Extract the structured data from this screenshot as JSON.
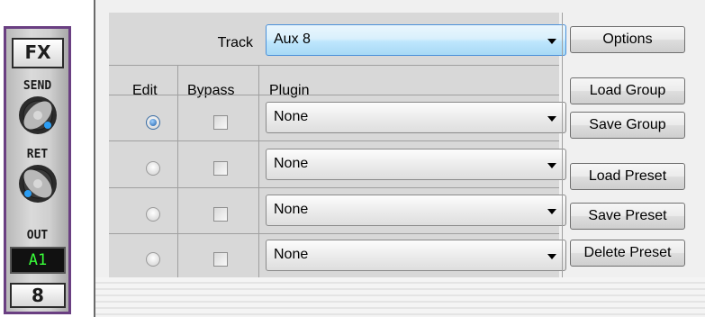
{
  "strip": {
    "fx_label": "FX",
    "send_label": "SEND",
    "ret_label": "RET",
    "out_label": "OUT",
    "out_value": "A1",
    "channel_number": "8",
    "colors": {
      "frame": "#6a3f82",
      "out_text": "#39ff39",
      "knob_dot": "#2a9df4"
    }
  },
  "track": {
    "label": "Track",
    "value": "Aux 8"
  },
  "headers": {
    "edit": "Edit",
    "bypass": "Bypass",
    "plugin": "Plugin"
  },
  "rows": [
    {
      "edit_selected": true,
      "bypass": false,
      "plugin": "None"
    },
    {
      "edit_selected": false,
      "bypass": false,
      "plugin": "None"
    },
    {
      "edit_selected": false,
      "bypass": false,
      "plugin": "None"
    },
    {
      "edit_selected": false,
      "bypass": false,
      "plugin": "None"
    }
  ],
  "buttons": {
    "options": "Options",
    "load_group": "Load Group",
    "save_group": "Save Group",
    "load_preset": "Load Preset",
    "save_preset": "Save Preset",
    "delete_preset": "Delete Preset"
  }
}
